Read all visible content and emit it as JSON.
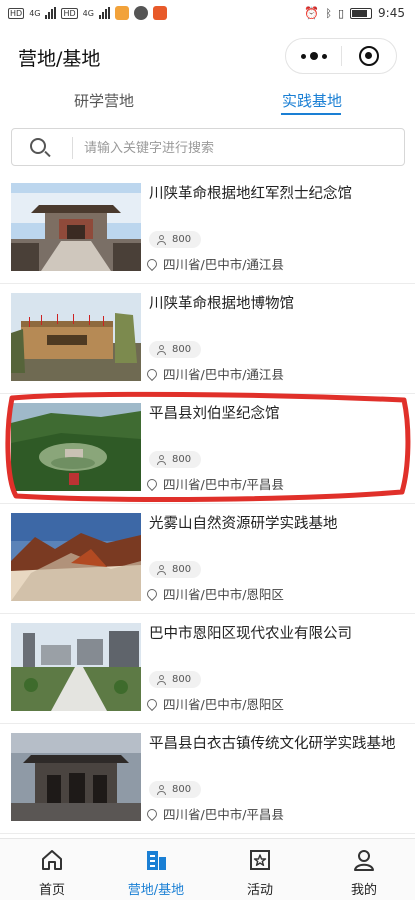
{
  "status_bar": {
    "network_badges": [
      "HD",
      "HD"
    ],
    "signal_labels": [
      "4G",
      "4G"
    ],
    "time": "9:45"
  },
  "header": {
    "title": "营地/基地"
  },
  "tabs": [
    {
      "label": "研学营地",
      "active": false
    },
    {
      "label": "实践基地",
      "active": true
    }
  ],
  "search": {
    "placeholder": "请输入关键字进行搜索"
  },
  "items": [
    {
      "name": "川陕革命根据地红军烈士纪念馆",
      "count": "800",
      "location": "四川省/巴中市/通江县"
    },
    {
      "name": "川陕革命根据地博物馆",
      "count": "800",
      "location": "四川省/巴中市/通江县"
    },
    {
      "name": "平昌县刘伯坚纪念馆",
      "count": "800",
      "location": "四川省/巴中市/平昌县"
    },
    {
      "name": "光雾山自然资源研学实践基地",
      "count": "800",
      "location": "四川省/巴中市/恩阳区"
    },
    {
      "name": "巴中市恩阳区现代农业有限公司",
      "count": "800",
      "location": "四川省/巴中市/恩阳区"
    },
    {
      "name": "平昌县白衣古镇传统文化研学实践基地",
      "count": "800",
      "location": "四川省/巴中市/平昌县"
    }
  ],
  "bottom_nav": [
    {
      "label": "首页",
      "icon": "home-icon",
      "active": false
    },
    {
      "label": "营地/基地",
      "icon": "building-icon",
      "active": true
    },
    {
      "label": "活动",
      "icon": "star-calendar-icon",
      "active": false
    },
    {
      "label": "我的",
      "icon": "person-icon",
      "active": false
    }
  ],
  "colors": {
    "accent": "#1a7fd4",
    "annotation": "#e0302a"
  }
}
